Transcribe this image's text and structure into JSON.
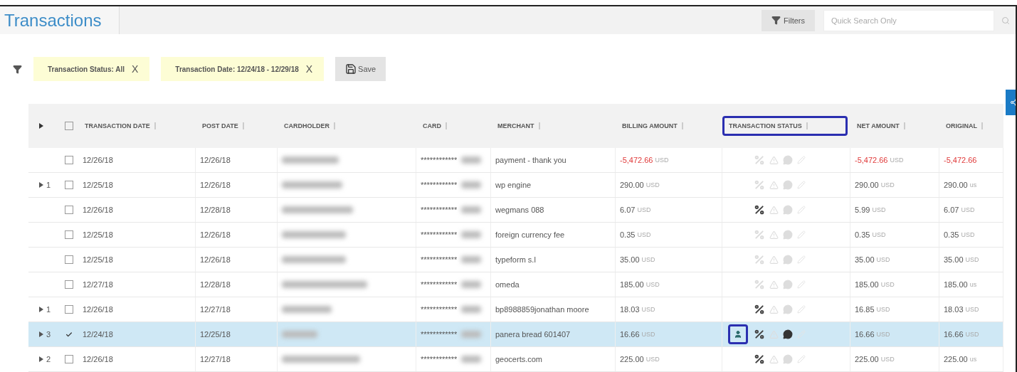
{
  "title": "Transactions",
  "toolbar": {
    "filters_label": "Filters",
    "search": {
      "placeholder": "Quick Search Only"
    }
  },
  "filter_chips": [
    {
      "label": "Transaction Status: All",
      "remove": "X"
    },
    {
      "label": "Transaction Date: 12/24/18 - 12/29/18",
      "remove": "X"
    }
  ],
  "save_label": "Save",
  "table": {
    "all_checked": false,
    "columns": [
      {
        "label": "TRANSACTION DATE",
        "highlighted": false
      },
      {
        "label": "POST DATE",
        "highlighted": false
      },
      {
        "label": "CARDHOLDER",
        "highlighted": false
      },
      {
        "label": "CARD",
        "highlighted": false
      },
      {
        "label": "MERCHANT",
        "highlighted": false
      },
      {
        "label": "BILLING AMOUNT",
        "highlighted": false
      },
      {
        "label": "TRANSACTION STATUS",
        "highlighted": true
      },
      {
        "label": "NET AMOUNT",
        "highlighted": false
      },
      {
        "label": "ORIGINAL",
        "highlighted": false
      }
    ],
    "rows": [
      {
        "count": "",
        "checked": false,
        "selected": false,
        "transaction_date": "12/26/18",
        "post_date": "12/26/18",
        "card": "************",
        "merchant": "payment - thank you",
        "billing": {
          "amount": "-5,472.66",
          "currency": "USD",
          "negative": true
        },
        "person_badge": false,
        "discount": false,
        "alert": false,
        "comment": false,
        "edit": false,
        "net": {
          "amount": "-5,472.66",
          "currency": "USD",
          "negative": true
        },
        "original": {
          "amount": "-5,472.66",
          "negative": true
        }
      },
      {
        "count": "1",
        "checked": false,
        "selected": false,
        "transaction_date": "12/25/18",
        "post_date": "12/26/18",
        "card": "************",
        "merchant": "wp engine",
        "billing": {
          "amount": "290.00",
          "currency": "USD",
          "negative": false
        },
        "person_badge": false,
        "discount": false,
        "alert": false,
        "comment": false,
        "edit": false,
        "net": {
          "amount": "290.00",
          "currency": "USD",
          "negative": false
        },
        "original": {
          "amount": "290.00",
          "currency": "us",
          "negative": false
        }
      },
      {
        "count": "",
        "checked": false,
        "selected": false,
        "transaction_date": "12/26/18",
        "post_date": "12/28/18",
        "card": "************",
        "merchant": "wegmans 088",
        "billing": {
          "amount": "6.07",
          "currency": "USD",
          "negative": false
        },
        "person_badge": false,
        "discount": true,
        "alert": false,
        "comment": false,
        "edit": false,
        "net": {
          "amount": "5.99",
          "currency": "USD",
          "negative": false
        },
        "original": {
          "amount": "6.07",
          "currency": "USD",
          "negative": false
        }
      },
      {
        "count": "",
        "checked": false,
        "selected": false,
        "transaction_date": "12/25/18",
        "post_date": "12/26/18",
        "card": "************",
        "merchant": "foreign currency fee",
        "billing": {
          "amount": "0.35",
          "currency": "USD",
          "negative": false
        },
        "person_badge": false,
        "discount": false,
        "alert": false,
        "comment": false,
        "edit": false,
        "net": {
          "amount": "0.35",
          "currency": "USD",
          "negative": false
        },
        "original": {
          "amount": "0.35",
          "currency": "USD",
          "negative": false
        }
      },
      {
        "count": "",
        "checked": false,
        "selected": false,
        "transaction_date": "12/25/18",
        "post_date": "12/26/18",
        "card": "************",
        "merchant": "typeform s.l",
        "billing": {
          "amount": "35.00",
          "currency": "USD",
          "negative": false
        },
        "person_badge": false,
        "discount": false,
        "alert": false,
        "comment": false,
        "edit": false,
        "net": {
          "amount": "35.00",
          "currency": "USD",
          "negative": false
        },
        "original": {
          "amount": "35.00",
          "currency": "USD",
          "negative": false
        }
      },
      {
        "count": "",
        "checked": false,
        "selected": false,
        "transaction_date": "12/27/18",
        "post_date": "12/28/18",
        "card": "************",
        "merchant": "omeda",
        "billing": {
          "amount": "185.00",
          "currency": "USD",
          "negative": false
        },
        "person_badge": false,
        "discount": false,
        "alert": false,
        "comment": false,
        "edit": false,
        "net": {
          "amount": "185.00",
          "currency": "USD",
          "negative": false
        },
        "original": {
          "amount": "185.00",
          "currency": "us",
          "negative": false
        }
      },
      {
        "count": "1",
        "checked": false,
        "selected": false,
        "transaction_date": "12/26/18",
        "post_date": "12/27/18",
        "card": "************",
        "merchant": "bp8988859jonathan moore",
        "billing": {
          "amount": "18.03",
          "currency": "USD",
          "negative": false
        },
        "person_badge": false,
        "discount": true,
        "alert": false,
        "comment": false,
        "edit": false,
        "net": {
          "amount": "16.85",
          "currency": "USD",
          "negative": false
        },
        "original": {
          "amount": "18.03",
          "currency": "USD",
          "negative": false
        }
      },
      {
        "count": "3",
        "checked": true,
        "selected": true,
        "transaction_date": "12/24/18",
        "post_date": "12/25/18",
        "card": "************",
        "merchant": "panera bread 601407",
        "billing": {
          "amount": "16.66",
          "currency": "USD",
          "negative": false
        },
        "person_badge": true,
        "discount": true,
        "alert": false,
        "comment": true,
        "edit": false,
        "net": {
          "amount": "16.66",
          "currency": "USD",
          "negative": false
        },
        "original": {
          "amount": "16.66",
          "currency": "USD",
          "negative": false
        }
      },
      {
        "count": "2",
        "checked": false,
        "selected": false,
        "transaction_date": "12/26/18",
        "post_date": "12/27/18",
        "card": "************",
        "merchant": "geocerts.com",
        "billing": {
          "amount": "225.00",
          "currency": "USD",
          "negative": false
        },
        "person_badge": false,
        "discount": true,
        "alert": false,
        "comment": false,
        "edit": false,
        "net": {
          "amount": "225.00",
          "currency": "USD",
          "negative": false
        },
        "original": {
          "amount": "225.00",
          "currency": "us",
          "negative": false
        }
      }
    ]
  }
}
